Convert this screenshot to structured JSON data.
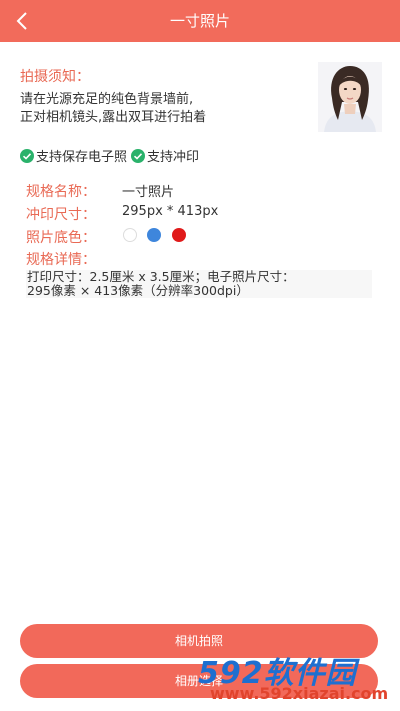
{
  "header": {
    "title": "一寸照片",
    "back_icon": "chevron-left-icon"
  },
  "notice": {
    "title": "拍摄须知：",
    "line1": "请在光源充足的纯色背景墙前,",
    "line2": "正对相机镜头,露出双耳进行拍着"
  },
  "features": {
    "item1": "支持保存电子照",
    "item2": "支持冲印",
    "icon": "check-circle-icon",
    "icon_color": "#2ab26b"
  },
  "spec": {
    "name_label": "规格名称：",
    "name_value": "一寸照片",
    "size_label": "冲印尺寸：",
    "size_value": "295px * 413px",
    "bg_label": "照片底色：",
    "bg_colors": [
      "#ffffff",
      "#3e86dc",
      "#e01a1a"
    ],
    "detail_label": "规格详情：",
    "detail_line1": "打印尺寸：2.5厘米 x 3.5厘米；电子照片尺寸：",
    "detail_line2": "295像素 × 413像素（分辨率300dpi）"
  },
  "buttons": {
    "camera": "相机拍照",
    "album": "相册选择"
  },
  "watermark": {
    "logo_num": "592",
    "logo_cn": "软件园",
    "url": "www.592xiazai.com"
  },
  "colors": {
    "accent": "#f26b5b",
    "label": "#e96a55"
  }
}
